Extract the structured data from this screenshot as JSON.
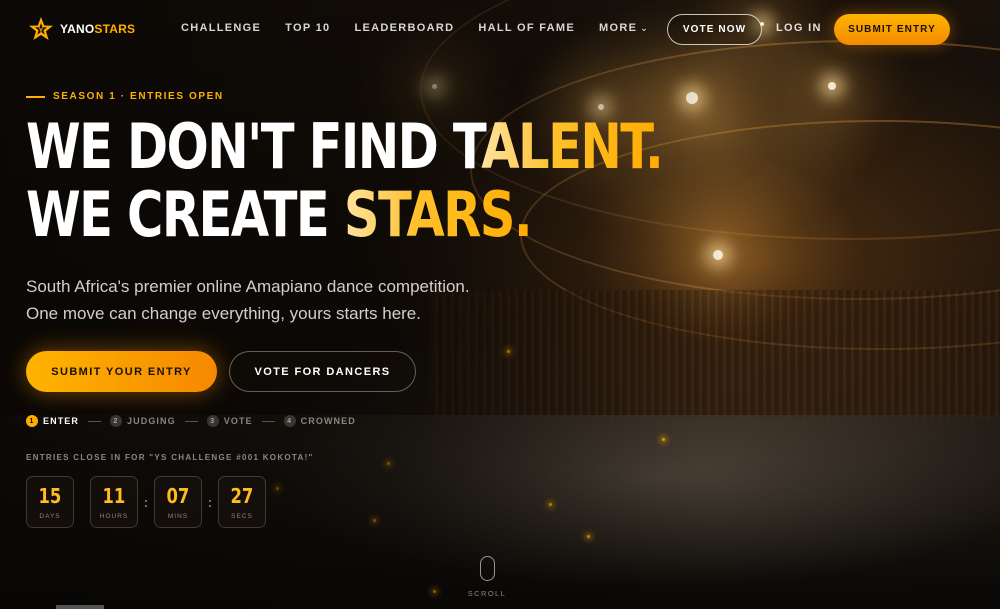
{
  "brand": {
    "name_part1": "YANO",
    "name_part2": "STARS",
    "logo_icon": "star-icon",
    "accent": "#ffb000"
  },
  "nav": {
    "links": [
      "CHALLENGE",
      "TOP 10",
      "LEADERBOARD",
      "HALL OF FAME",
      "MORE"
    ],
    "more_icon": "chevron-down-icon",
    "vote_now": "VOTE NOW",
    "login": "LOG IN",
    "submit_entry": "SUBMIT ENTRY"
  },
  "hero": {
    "eyebrow": "SEASON 1 · ENTRIES OPEN",
    "headline_line1_a": "WE DON'T FIND T",
    "headline_line1_b": "ALENT.",
    "headline_line2_a": "WE CREATE ",
    "headline_line2_b": "STARS.",
    "subtitle_line1": "South Africa's premier online Amapiano dance competition.",
    "subtitle_line2": "One move can change everything, yours starts here.",
    "cta_primary": "SUBMIT YOUR ENTRY",
    "cta_secondary": "VOTE FOR DANCERS"
  },
  "steps": [
    {
      "num": "1",
      "label": "ENTER",
      "active": true
    },
    {
      "num": "2",
      "label": "JUDGING",
      "active": false
    },
    {
      "num": "3",
      "label": "VOTE",
      "active": false
    },
    {
      "num": "4",
      "label": "CROWNED",
      "active": false
    }
  ],
  "countdown": {
    "label": "ENTRIES CLOSE IN FOR \"YS CHALLENGE #001 KOKOTA!\"",
    "items": [
      {
        "value": "15",
        "unit": "DAYS"
      },
      {
        "value": "11",
        "unit": "HOURS"
      },
      {
        "value": "07",
        "unit": "MINS"
      },
      {
        "value": "27",
        "unit": "SECS"
      }
    ]
  },
  "scroll": {
    "label": "SCROLL",
    "icon": "mouse-icon"
  }
}
